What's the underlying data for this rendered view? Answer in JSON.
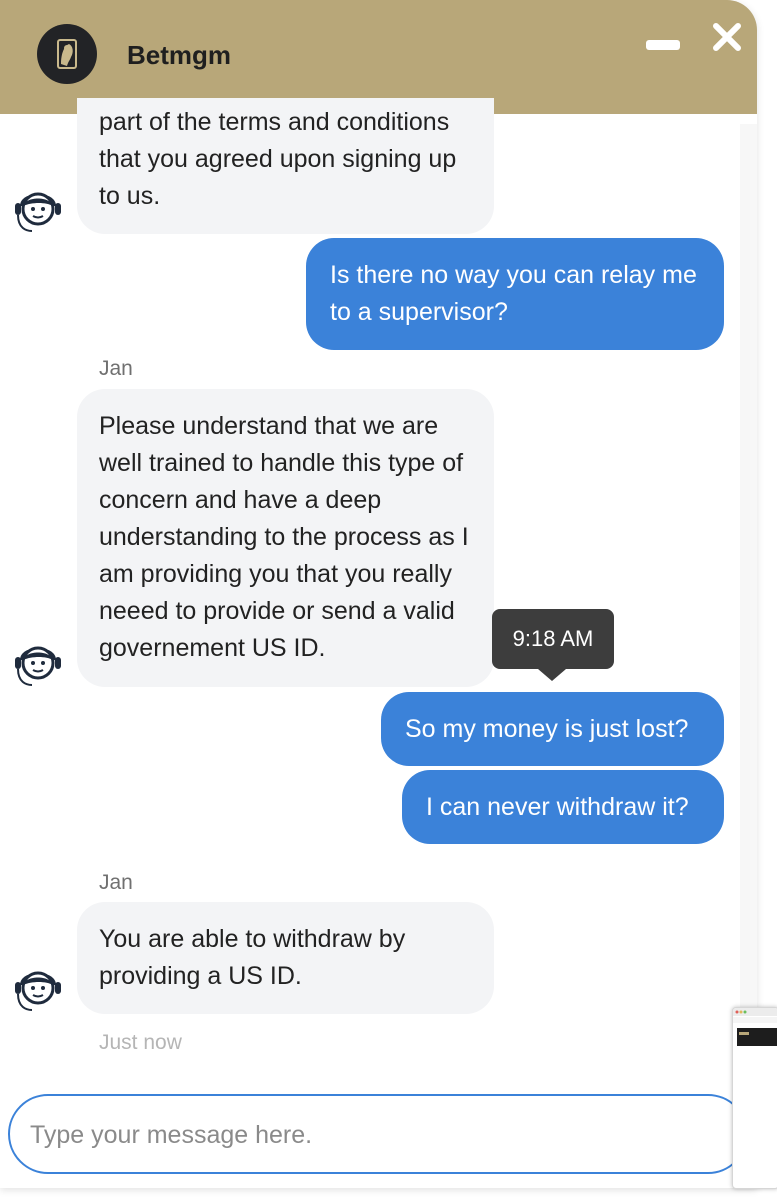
{
  "colors": {
    "brand": "#b8a779",
    "user_bubble": "#3b82d9",
    "agent_bubble": "#f3f4f6"
  },
  "header": {
    "title": "Betmgm",
    "logo_icon": "lion-logo-icon",
    "minimize_icon": "minimize-icon",
    "close_icon": "close-icon"
  },
  "messages": [
    {
      "from": "agent",
      "text": "part of the terms and conditions that you agreed upon signing up to us."
    },
    {
      "from": "user",
      "text": "Is there no way you can relay me to a supervisor?"
    },
    {
      "from": "agent",
      "sender": "Jan",
      "text": "Please understand that we are well trained to handle this type of concern and have a deep understanding to the process as I am providing you that you really neeed to provide or send a valid governement US ID."
    },
    {
      "from": "user",
      "text": "So my money is just lost?"
    },
    {
      "from": "user",
      "text": "I can never withdraw it?"
    },
    {
      "from": "agent",
      "sender": "Jan",
      "text": "You are able to withdraw by providing a US ID.",
      "timestamp": "Just now"
    }
  ],
  "tooltip": {
    "text": "9:18 AM"
  },
  "composer": {
    "placeholder": "Type your message here.",
    "value": ""
  },
  "agent_avatar_icon": "support-agent-headset-icon"
}
